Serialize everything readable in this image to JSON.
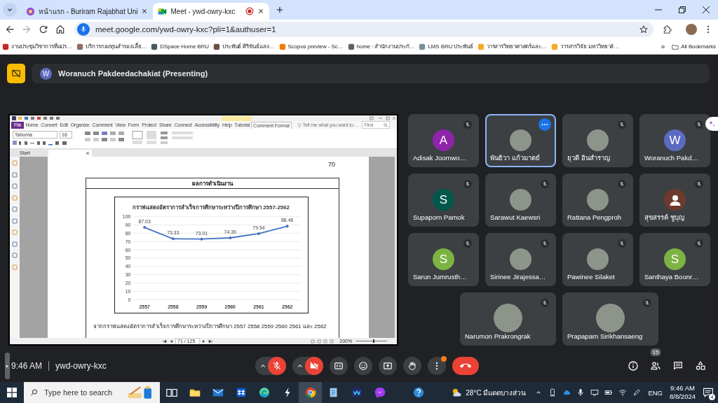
{
  "browser": {
    "tabs": [
      {
        "title": "หน้าแรก - Buriram Rajabhat Uni",
        "selected": false,
        "recording": false
      },
      {
        "title": "Meet - ywd-owry-kxc",
        "selected": true,
        "recording": true
      }
    ],
    "url": "meet.google.com/ywd-owry-kxc?pli=1&authuser=1",
    "bookmarks": [
      "งานประชุมวิชาการที่แปร…",
      "บริการกองทุนสำรองเลี้ย…",
      "DSpace Home BRU",
      "ประพันธ์ ศิริขันธ์แสง…",
      "Scopus preview - Sc…",
      "home : สำนักงานประกั…",
      "LMS BRU ประพันธ์",
      "วารสารวิทยาศาสตร์และ…",
      "วารสารวิจัย มหาวิทยาลั…"
    ],
    "more_bookmarks": "»",
    "all_bookmarks": "All Bookmarks"
  },
  "meet": {
    "presenter": {
      "initial": "W",
      "name": "Woranuch Pakdeedachakiat (Presenting)"
    },
    "shared_screen": {
      "ribbon_tabs": [
        {
          "label": "File",
          "kind": "menu",
          "selected": false
        },
        {
          "label": "Home",
          "kind": "tab",
          "selected": false
        },
        {
          "label": "Convert",
          "kind": "tab",
          "selected": false
        },
        {
          "label": "Edit",
          "kind": "tab",
          "selected": false
        },
        {
          "label": "Organize",
          "kind": "tab",
          "selected": false
        },
        {
          "label": "Comment",
          "kind": "tab",
          "selected": false
        },
        {
          "label": "View",
          "kind": "tab",
          "selected": false
        },
        {
          "label": "Form",
          "kind": "tab",
          "selected": false
        },
        {
          "label": "Protect",
          "kind": "tab",
          "selected": false
        },
        {
          "label": "Share",
          "kind": "tab",
          "selected": false
        },
        {
          "label": "Connect",
          "kind": "tab",
          "selected": false
        },
        {
          "label": "Accessibility",
          "kind": "tab",
          "selected": false
        },
        {
          "label": "Help",
          "kind": "tab",
          "selected": false
        },
        {
          "label": "Tutorial",
          "kind": "tab",
          "selected": false
        },
        {
          "label": "Comment Format",
          "kind": "tab",
          "selected": true
        }
      ],
      "tell_me": {
        "placeholder": "Tell me what you want to…"
      },
      "find": {
        "placeholder": "Find"
      },
      "font_name": "Tahoma",
      "font_size": "16",
      "start_tab": "Start",
      "page_number": "70",
      "section_title": "ผลการดำเนินงาน",
      "chart_data": {
        "type": "line",
        "title": "กราฟแสดงอัตราการสำเร็จการศึกษาระหว่างปีการศึกษา 2557-2562",
        "categories": [
          "2557",
          "2558",
          "2559",
          "2560",
          "2561",
          "2562"
        ],
        "values": [
          87.03,
          73.33,
          73.01,
          74.39,
          79.54,
          88.46
        ],
        "ylim": [
          0,
          100
        ],
        "yticks": [
          0,
          10,
          20,
          30,
          40,
          50,
          60,
          70,
          80,
          90,
          100
        ],
        "grid": true,
        "data_labels": true
      },
      "paragraph": "จากกราฟแสดงอัตราการสำเร็จการศึกษาระหว่างปีการศึกษา 2557 2558 2559 2560 2561 และ 2562",
      "page_field": "71 / 125",
      "zoom": "200%",
      "zoom_slider": {
        "level": 0.55
      }
    },
    "participants": [
      {
        "name": "Adisak Joomwo…",
        "kind": "letter",
        "initial": "A",
        "color": "#8e24aa",
        "muted": true,
        "selected": false
      },
      {
        "name": "พันธิวา แก้วมาตย์",
        "kind": "photo",
        "selected": true
      },
      {
        "name": "ยุวดี อินสำราญ",
        "kind": "photo",
        "muted": true,
        "selected": false
      },
      {
        "name": "Woranuch Pakd…",
        "kind": "letter",
        "initial": "W",
        "color": "#5c6bc0",
        "muted": true,
        "selected": false
      },
      {
        "name": "Supaporn Pamok",
        "kind": "letter",
        "initial": "S",
        "color": "#00574b",
        "muted": true,
        "selected": false
      },
      {
        "name": "Sarawut Kaewsri",
        "kind": "photo",
        "muted": true,
        "selected": false
      },
      {
        "name": "Rattana Pengproh",
        "kind": "photo",
        "muted": true,
        "selected": false
      },
      {
        "name": "สุขสรรค์ ชูบุญ",
        "kind": "silhouette",
        "color": "#6d3b2e",
        "muted": true,
        "selected": false
      },
      {
        "name": "Sarun Jumrusth…",
        "kind": "letter",
        "initial": "S",
        "color": "#7cb342",
        "muted": true,
        "selected": false
      },
      {
        "name": "Sirinee Jirajessa…",
        "kind": "photo",
        "muted": true,
        "selected": false
      },
      {
        "name": "Pawinee Silaket",
        "kind": "photo",
        "muted": true,
        "selected": false
      },
      {
        "name": "Santhaya Boonr…",
        "kind": "letter",
        "initial": "S",
        "color": "#7cb342",
        "muted": true,
        "selected": false
      },
      {
        "name": "Narumon Prakrongrak",
        "kind": "photo",
        "muted": true,
        "selected": false
      },
      {
        "name": "Prapaparn Sirikhansaeng",
        "kind": "photo",
        "muted": true,
        "selected": false
      }
    ],
    "meeting_time": "9:46 AM",
    "meeting_code": "ywd-owry-kxc",
    "controls": [
      {
        "kind": "mic",
        "on": false
      },
      {
        "kind": "camera",
        "on": false
      },
      {
        "kind": "captions"
      },
      {
        "kind": "emoji"
      },
      {
        "kind": "present"
      },
      {
        "kind": "hand"
      },
      {
        "kind": "more",
        "notification": true
      },
      {
        "kind": "leave"
      }
    ],
    "people_count": "15"
  },
  "taskbar": {
    "search": {
      "placeholder": "Type here to search"
    },
    "apps": [
      {
        "selected": false
      },
      {
        "selected": false
      },
      {
        "selected": false
      },
      {
        "selected": false
      },
      {
        "selected": false
      },
      {
        "selected": false
      },
      {
        "selected": true
      },
      {
        "selected": false
      },
      {
        "selected": false
      },
      {
        "selected": false
      },
      {
        "selected": false
      }
    ],
    "weather": "28°C มีแดดบางส่วน",
    "language": "ENG",
    "time": "9:46 AM",
    "date": "8/8/2024",
    "notifications": "4"
  }
}
